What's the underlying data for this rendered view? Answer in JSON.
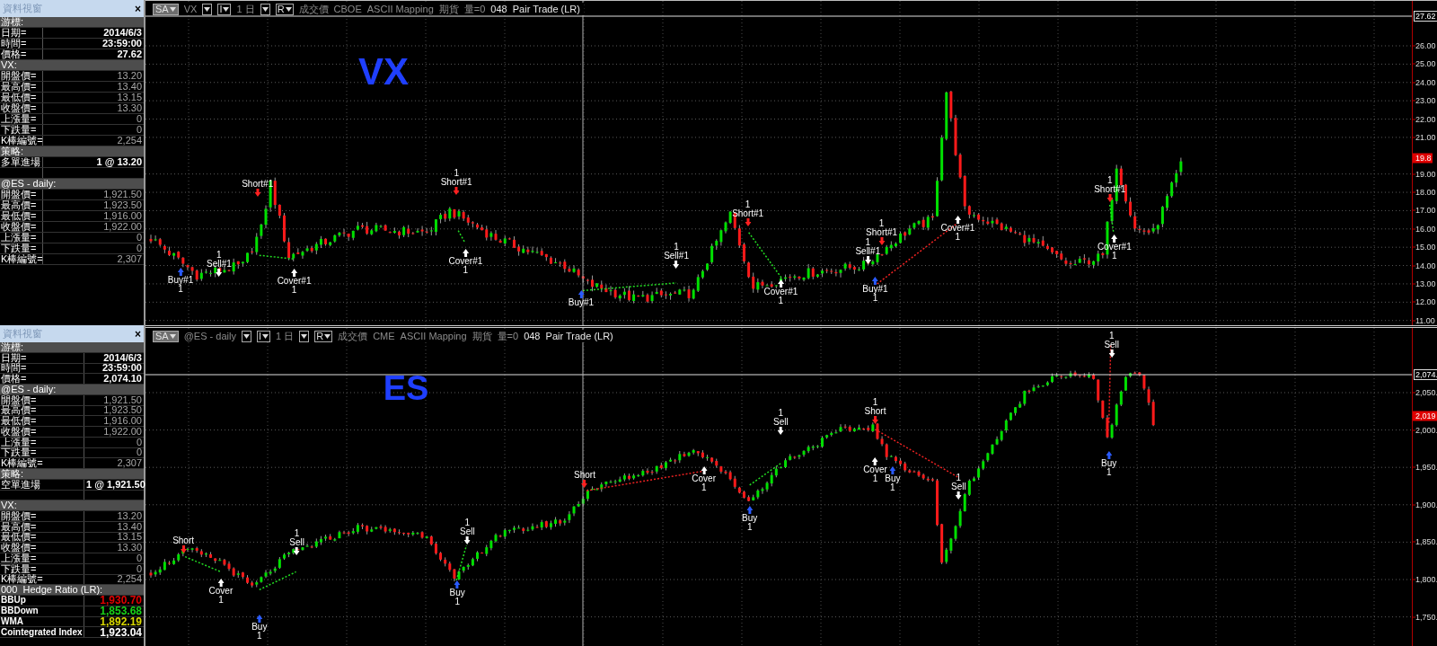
{
  "panels": [
    {
      "title": "資料視窗",
      "close": "×",
      "rows": [
        {
          "kind": "section",
          "label": "游標:"
        },
        {
          "kind": "cursor",
          "label": "日期=",
          "value": "2014/6/3"
        },
        {
          "kind": "cursor",
          "label": "時間=",
          "value": "23:59:00"
        },
        {
          "kind": "cursor",
          "label": "價格=",
          "value": "27.62"
        },
        {
          "kind": "section",
          "label": "VX:"
        },
        {
          "kind": "quote",
          "label": "開盤價=",
          "value": "13.20"
        },
        {
          "kind": "quote",
          "label": "最高價=",
          "value": "13.40"
        },
        {
          "kind": "quote",
          "label": "最低價=",
          "value": "13.15"
        },
        {
          "kind": "quote",
          "label": "收盤價=",
          "value": "13.30"
        },
        {
          "kind": "quote",
          "label": "上漲量=",
          "value": "0"
        },
        {
          "kind": "quote",
          "label": "下跌量=",
          "value": "0"
        },
        {
          "kind": "quote",
          "label": "K棒編號=",
          "value": "2,254"
        },
        {
          "kind": "section",
          "label": "策略:"
        },
        {
          "kind": "entry",
          "label": "多單進場",
          "value": "1 @ 13.20"
        },
        {
          "kind": "blank"
        },
        {
          "kind": "section",
          "label": "@ES - daily:"
        },
        {
          "kind": "quote",
          "label": "開盤價=",
          "value": "1,921.50"
        },
        {
          "kind": "quote",
          "label": "最高價=",
          "value": "1,923.50"
        },
        {
          "kind": "quote",
          "label": "最低價=",
          "value": "1,916.00"
        },
        {
          "kind": "quote",
          "label": "收盤價=",
          "value": "1,922.00"
        },
        {
          "kind": "quote",
          "label": "上漲量=",
          "value": "0"
        },
        {
          "kind": "quote",
          "label": "下跌量=",
          "value": "0"
        },
        {
          "kind": "quote",
          "label": "K棒編號=",
          "value": "2,307"
        }
      ]
    },
    {
      "title": "資料視窗",
      "close": "×",
      "rows": [
        {
          "kind": "section",
          "label": "游標:"
        },
        {
          "kind": "cursor",
          "label": "日期=",
          "value": "2014/6/3"
        },
        {
          "kind": "cursor",
          "label": "時間=",
          "value": "23:59:00"
        },
        {
          "kind": "cursor",
          "label": "價格=",
          "value": "2,074.10"
        },
        {
          "kind": "section",
          "label": "@ES - daily:"
        },
        {
          "kind": "quote",
          "label": "開盤價=",
          "value": "1,921.50"
        },
        {
          "kind": "quote",
          "label": "最高價=",
          "value": "1,923.50"
        },
        {
          "kind": "quote",
          "label": "最低價=",
          "value": "1,916.00"
        },
        {
          "kind": "quote",
          "label": "收盤價=",
          "value": "1,922.00"
        },
        {
          "kind": "quote",
          "label": "上漲量=",
          "value": "0"
        },
        {
          "kind": "quote",
          "label": "下跌量=",
          "value": "0"
        },
        {
          "kind": "quote",
          "label": "K棒編號=",
          "value": "2,307"
        },
        {
          "kind": "section",
          "label": "策略:"
        },
        {
          "kind": "entry",
          "label": "空單進場",
          "value": "1 @ 1,921.50"
        },
        {
          "kind": "blank"
        },
        {
          "kind": "section",
          "label": "VX:"
        },
        {
          "kind": "quote",
          "label": "開盤價=",
          "value": "13.20"
        },
        {
          "kind": "quote",
          "label": "最高價=",
          "value": "13.40"
        },
        {
          "kind": "quote",
          "label": "最低價=",
          "value": "13.15"
        },
        {
          "kind": "quote",
          "label": "收盤價=",
          "value": "13.30"
        },
        {
          "kind": "quote",
          "label": "上漲量=",
          "value": "0"
        },
        {
          "kind": "quote",
          "label": "下跌量=",
          "value": "0"
        },
        {
          "kind": "quote",
          "label": "K棒編號=",
          "value": "2,254"
        },
        {
          "kind": "section",
          "label": "000  Hedge Ratio (LR):"
        },
        {
          "kind": "indicator",
          "label": "BBUp",
          "value": "1,930.70",
          "color": "#e00000"
        },
        {
          "kind": "indicator",
          "label": "BBDown",
          "value": "1,853.68",
          "color": "#19d219"
        },
        {
          "kind": "indicator",
          "label": "WMA",
          "value": "1,892.19",
          "color": "#d8d800"
        },
        {
          "kind": "indicator",
          "label": "Cointegrated Index",
          "value": "1,923.04",
          "color": "#ffffff"
        }
      ]
    }
  ],
  "charts": [
    {
      "toolbar": [
        {
          "kind": "menu",
          "label": "SA"
        },
        {
          "kind": "text",
          "label": "VX"
        },
        {
          "kind": "dropdown"
        },
        {
          "kind": "dropdown",
          "label": "I"
        },
        {
          "kind": "text",
          "label": "1 日"
        },
        {
          "kind": "dropdown"
        },
        {
          "kind": "dropdown",
          "label": "R"
        },
        {
          "kind": "text",
          "label": "成交價"
        },
        {
          "kind": "text",
          "label": "CBOE"
        },
        {
          "kind": "text",
          "label": "ASCII Mapping"
        },
        {
          "kind": "text",
          "label": "期貨"
        },
        {
          "kind": "text",
          "label": "量=0"
        },
        {
          "kind": "title",
          "label": "048  Pair Trade (LR)"
        }
      ],
      "symbol_label": "VX",
      "axis": {
        "ticks": [
          "26.00",
          "25.00",
          "24.00",
          "23.00",
          "22.00",
          "21.00",
          "19.00",
          "18.00",
          "17.00",
          "16.00",
          "15.00",
          "14.00",
          "13.00",
          "12.00",
          "11.00"
        ],
        "cursor_price": "27.62",
        "last_price": "19.8"
      },
      "markers": [
        {
          "kind": "buy",
          "label": "Buy#1",
          "qty": "1"
        },
        {
          "kind": "sell",
          "label": "Sell#1",
          "qty": "1"
        },
        {
          "kind": "short",
          "label": "Short#1"
        },
        {
          "kind": "cover",
          "label": "Cover#1",
          "qty": "1"
        },
        {
          "kind": "short",
          "label": "Short#1",
          "qty": "1"
        },
        {
          "kind": "cover",
          "label": "Cover#1",
          "qty": "1"
        },
        {
          "kind": "buy",
          "label": "Buy#1"
        },
        {
          "kind": "sell",
          "label": "Sell#1",
          "qty": "1"
        },
        {
          "kind": "short",
          "label": "Short#1",
          "qty": "1"
        },
        {
          "kind": "cover",
          "label": "Cover#1",
          "qty": "1"
        },
        {
          "kind": "short",
          "label": "Short#1",
          "qty": "1"
        },
        {
          "kind": "sell",
          "label": "Sell#1",
          "qty": "1"
        },
        {
          "kind": "buy",
          "label": "Buy#1",
          "qty": "1"
        },
        {
          "kind": "cover",
          "label": "Cover#1",
          "qty": "1"
        },
        {
          "kind": "short",
          "label": "Short#1",
          "qty": "1"
        },
        {
          "kind": "cover",
          "label": "Cover#1",
          "qty": "1"
        }
      ]
    },
    {
      "toolbar": [
        {
          "kind": "menu",
          "label": "SA"
        },
        {
          "kind": "text",
          "label": "@ES - daily"
        },
        {
          "kind": "dropdown"
        },
        {
          "kind": "dropdown",
          "label": "I"
        },
        {
          "kind": "text",
          "label": "1 日"
        },
        {
          "kind": "dropdown"
        },
        {
          "kind": "dropdown",
          "label": "R"
        },
        {
          "kind": "text",
          "label": "成交價"
        },
        {
          "kind": "text",
          "label": "CME"
        },
        {
          "kind": "text",
          "label": "ASCII Mapping"
        },
        {
          "kind": "text",
          "label": "期貨"
        },
        {
          "kind": "text",
          "label": "量=0"
        },
        {
          "kind": "title",
          "label": "048  Pair Trade (LR)"
        }
      ],
      "symbol_label": "ES",
      "axis": {
        "ticks": [
          "2,050.",
          "2,000.",
          "1,950.",
          "1,900.",
          "1,850.",
          "1,800.",
          "1,750."
        ],
        "cursor_price": "2,074.",
        "last_price": "2,019"
      },
      "markers": [
        {
          "kind": "short",
          "label": "Short"
        },
        {
          "kind": "cover",
          "label": "Cover",
          "qty": "1"
        },
        {
          "kind": "sell",
          "label": "Sell",
          "qty": "1"
        },
        {
          "kind": "buy",
          "label": "Buy",
          "qty": "1"
        },
        {
          "kind": "sell",
          "label": "Sell",
          "qty": "1"
        },
        {
          "kind": "buy",
          "label": "Buy",
          "qty": "1"
        },
        {
          "kind": "short",
          "label": "Short"
        },
        {
          "kind": "cover",
          "label": "Cover",
          "qty": "1"
        },
        {
          "kind": "sell",
          "label": "Sell",
          "qty": "1"
        },
        {
          "kind": "buy",
          "label": "Buy",
          "qty": "1"
        },
        {
          "kind": "short",
          "label": "Short",
          "qty": "1"
        },
        {
          "kind": "cover",
          "label": "Cover",
          "qty": "1"
        },
        {
          "kind": "buy",
          "label": "Buy",
          "qty": "1"
        },
        {
          "kind": "sell",
          "label": "Sell",
          "qty": "1"
        },
        {
          "kind": "sell",
          "label": "Sell",
          "qty": "1"
        },
        {
          "kind": "buy",
          "label": "Buy",
          "qty": "1"
        }
      ]
    }
  ]
}
